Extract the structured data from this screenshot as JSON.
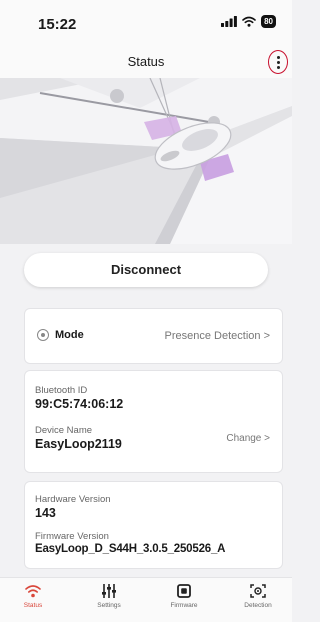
{
  "status_bar": {
    "time": "15:22",
    "battery": "80"
  },
  "nav": {
    "title": "Status",
    "menu_icon": "kebab-menu-icon"
  },
  "hero": {
    "image": "vehicle-over-ground-loop-illustration"
  },
  "actions": {
    "disconnect_label": "Disconnect"
  },
  "mode_card": {
    "label": "Mode",
    "value": "Presence Detection >"
  },
  "device_card": {
    "bluetooth_label": "Bluetooth ID",
    "bluetooth_value": "99:C5:74:06:12",
    "name_label": "Device Name",
    "name_value": "EasyLoop2119",
    "change_label": "Change >"
  },
  "hardware_card": {
    "hw_label": "Hardware Version",
    "hw_value": "143",
    "fw_label": "Firmware Version",
    "fw_value": "EasyLoop_D_S44H_3.0.5_250526_A"
  },
  "tabs": [
    {
      "label": "Status",
      "icon": "wifi-signal-icon",
      "active": true
    },
    {
      "label": "Settings",
      "icon": "sliders-icon",
      "active": false
    },
    {
      "label": "Firmware",
      "icon": "chip-icon",
      "active": false
    },
    {
      "label": "Detection",
      "icon": "detection-target-icon",
      "active": false
    }
  ],
  "colors": {
    "accent": "#d9473b",
    "highlight": "#c8102e",
    "background": "#f2f2f4"
  }
}
